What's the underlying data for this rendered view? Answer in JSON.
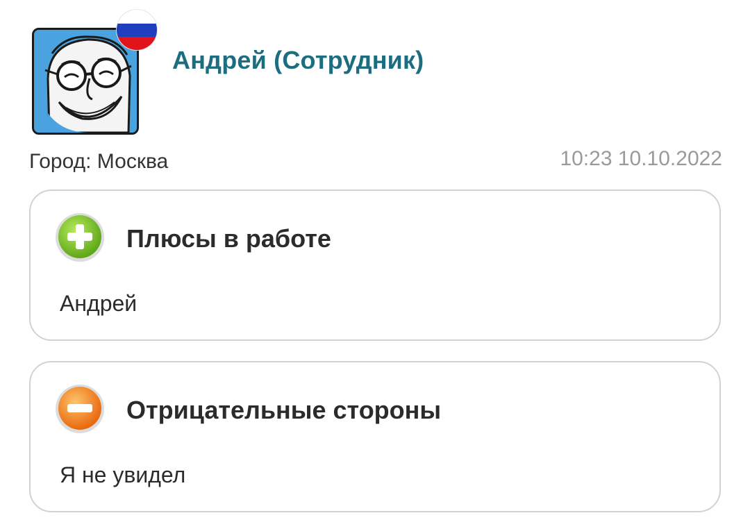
{
  "review": {
    "author_name": "Андрей (Сотрудник)",
    "country_flag": "russia-flag-icon",
    "city": "Город: Москва",
    "timestamp": "10:23 10.10.2022"
  },
  "pros": {
    "title": "Плюсы в работе",
    "text": "Андрей",
    "icon": "plus-circle-icon",
    "color": "#7cc22c"
  },
  "cons": {
    "title": "Отрицательные стороны",
    "text": "Я не увидел",
    "icon": "minus-circle-icon",
    "color": "#f08a1c"
  }
}
